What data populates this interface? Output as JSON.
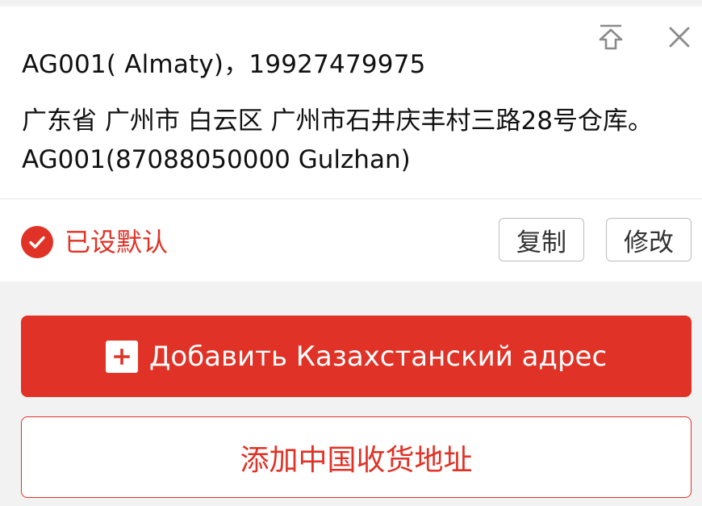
{
  "address_card": {
    "title": "AG001( Almaty)，19927479975",
    "address": "广东省 广州市 白云区 广州市石井庆丰村三路28号仓库。AG001(87088050000 Gulzhan)",
    "default_label": "已设默认",
    "copy_label": "复制",
    "edit_label": "修改",
    "icons": {
      "pin": "pin-to-top-icon",
      "close": "close-icon",
      "check": "check-circle-icon"
    }
  },
  "actions": {
    "add_kz_label": "Добавить Казахстанский адрес",
    "add_cn_label": "添加中国收货地址",
    "plus_icon": "plus-icon"
  },
  "colors": {
    "accent": "#e03226",
    "background": "#f2f2f2",
    "card": "#ffffff"
  }
}
